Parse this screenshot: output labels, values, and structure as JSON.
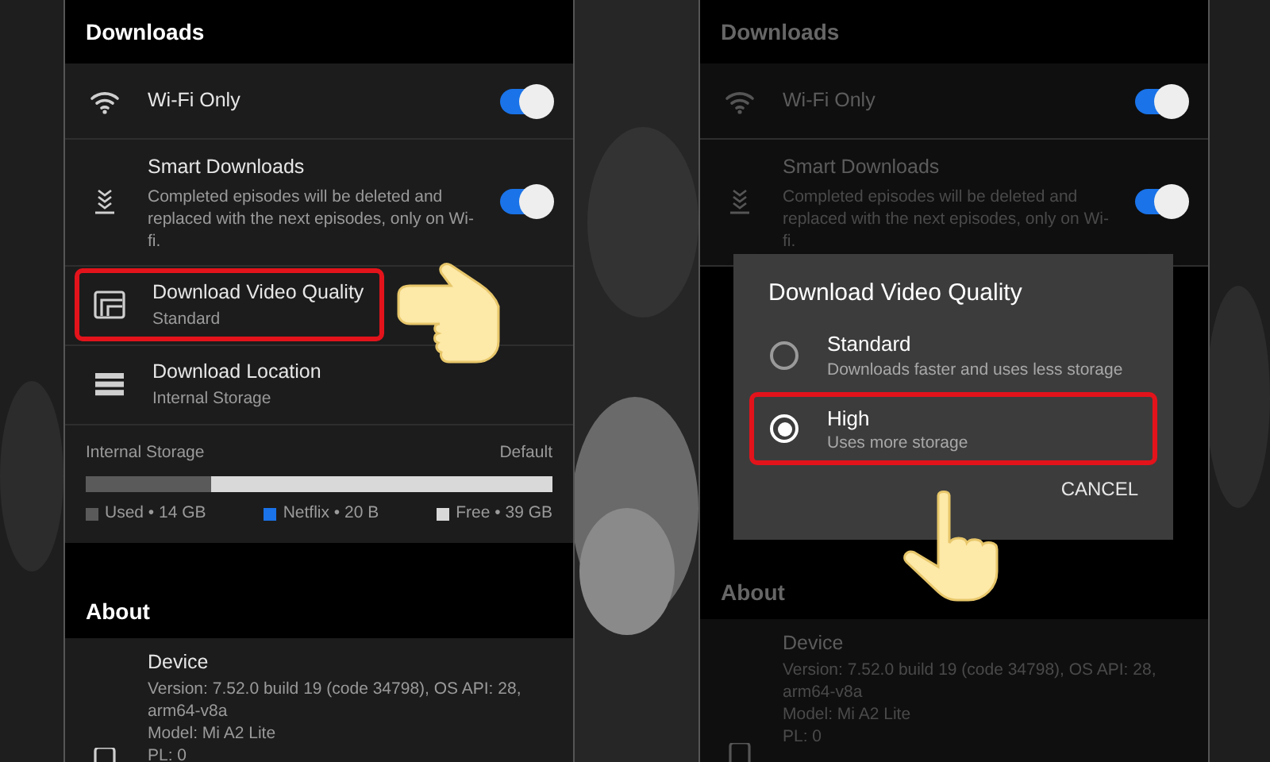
{
  "screens": [
    {
      "dimmed": false,
      "header": "Downloads",
      "settings": [
        {
          "kind": "toggle",
          "title": "Wi-Fi Only",
          "on": true
        },
        {
          "kind": "toggle",
          "title": "Smart Downloads",
          "description": "Completed episodes will be deleted and replaced with the next episodes, only on Wi-fi.",
          "on": true
        },
        {
          "kind": "option",
          "title": "Download Video Quality",
          "value": "Standard",
          "highlighted": true
        },
        {
          "kind": "option",
          "title": "Download Location",
          "value": "Internal Storage",
          "highlighted": false
        }
      ],
      "storage": {
        "label": "Internal Storage",
        "default_label": "Default",
        "level": 0.27,
        "legend": [
          {
            "label": "Used • 14 GB",
            "color": "#5a5a5a"
          },
          {
            "label": "Netflix • 20 B",
            "color": "#1a73e8"
          },
          {
            "label": "Free • 39 GB",
            "color": "#d9d9d9"
          }
        ]
      },
      "about": {
        "header": "About",
        "title": "Device",
        "lines": [
          "Version: 7.52.0 build 19 (code 34798), OS API: 28, arm64-v8a",
          "Model: Mi A2 Lite",
          "PL: 0"
        ]
      }
    },
    {
      "dimmed": true,
      "header": "Downloads",
      "settings": [
        {
          "kind": "toggle",
          "title": "Wi-Fi Only",
          "on": true
        },
        {
          "kind": "toggle",
          "title": "Smart Downloads",
          "description": "Completed episodes will be deleted and replaced with the next episodes, only on Wi-fi.",
          "on": true
        }
      ],
      "dialog": {
        "title": "Download Video Quality",
        "options": [
          {
            "title": "Standard",
            "description": "Downloads faster and uses less storage",
            "selected": false,
            "highlighted": false
          },
          {
            "title": "High",
            "description": "Uses more storage",
            "selected": true,
            "highlighted": true
          }
        ],
        "button": "CANCEL"
      },
      "about": {
        "header": "About",
        "title": "Device",
        "lines": [
          "Version: 7.52.0 build 19 (code 34798), OS API: 28, arm64-v8a",
          "Model: Mi A2 Lite",
          "PL: 0"
        ]
      }
    }
  ]
}
